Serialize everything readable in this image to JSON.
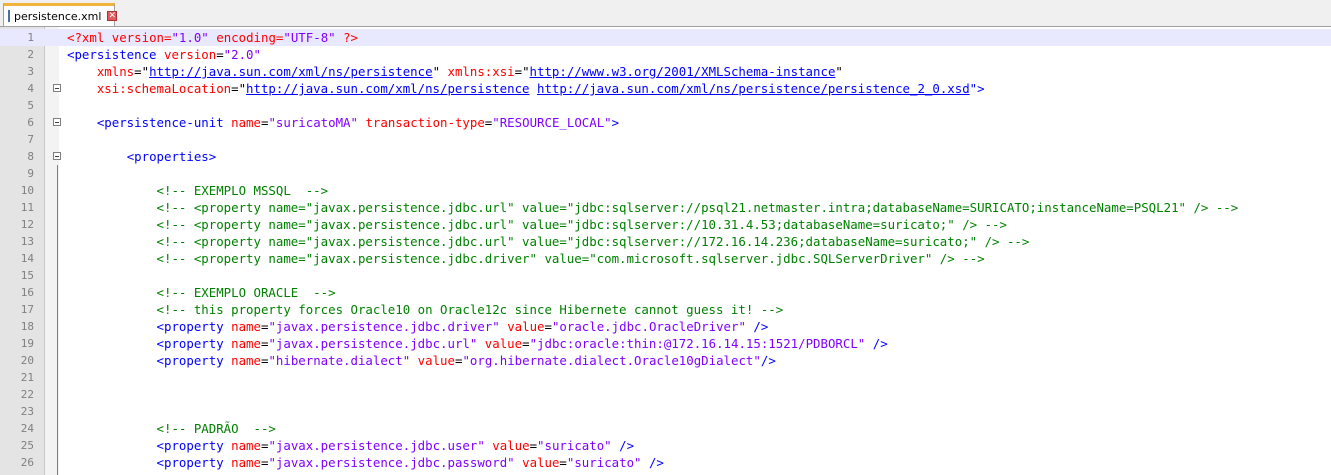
{
  "tab": {
    "filename": "persistence.xml",
    "close_glyph": "✕"
  },
  "colors": {
    "processing_instruction": "#ff0000",
    "tag": "#0000ff",
    "attribute": "#ff0000",
    "value": "#8000ff",
    "comment": "#008000",
    "active_line": "#e8e8ff"
  },
  "lines": [
    {
      "n": "1",
      "indent": "",
      "tokens": [
        {
          "t": "<?xml ",
          "c": "pi"
        },
        {
          "t": "version",
          "c": "attr"
        },
        {
          "t": "=",
          "c": "pi"
        },
        {
          "t": "\"1.0\"",
          "c": "val"
        },
        {
          "t": " ",
          "c": "plain"
        },
        {
          "t": "encoding",
          "c": "attr"
        },
        {
          "t": "=",
          "c": "pi"
        },
        {
          "t": "\"UTF-8\"",
          "c": "val"
        },
        {
          "t": " ?>",
          "c": "pi"
        }
      ]
    },
    {
      "n": "2",
      "indent": "",
      "tokens": [
        {
          "t": "<persistence ",
          "c": "tag"
        },
        {
          "t": "version",
          "c": "attr"
        },
        {
          "t": "=",
          "c": "plain"
        },
        {
          "t": "\"2.0\"",
          "c": "val"
        }
      ]
    },
    {
      "n": "3",
      "indent": "    ",
      "tokens": [
        {
          "t": "xmlns",
          "c": "attr"
        },
        {
          "t": "=\"",
          "c": "plain"
        },
        {
          "t": "http://java.sun.com/xml/ns/persistence",
          "c": "url"
        },
        {
          "t": "\" ",
          "c": "plain"
        },
        {
          "t": "xmlns:xsi",
          "c": "attr"
        },
        {
          "t": "=\"",
          "c": "plain"
        },
        {
          "t": "http://www.w3.org/2001/XMLSchema-instance",
          "c": "url"
        },
        {
          "t": "\"",
          "c": "plain"
        }
      ]
    },
    {
      "n": "4",
      "indent": "    ",
      "tokens": [
        {
          "t": "xsi:schemaLocation",
          "c": "attr"
        },
        {
          "t": "=\"",
          "c": "plain"
        },
        {
          "t": "http://java.sun.com/xml/ns/persistence",
          "c": "url"
        },
        {
          "t": " ",
          "c": "plain"
        },
        {
          "t": "http://java.sun.com/xml/ns/persistence/persistence_2_0.xsd",
          "c": "url"
        },
        {
          "t": "\">",
          "c": "tag"
        }
      ]
    },
    {
      "n": "5",
      "indent": "",
      "tokens": []
    },
    {
      "n": "6",
      "indent": "    ",
      "tokens": [
        {
          "t": "<persistence-unit ",
          "c": "tag"
        },
        {
          "t": "name",
          "c": "attr"
        },
        {
          "t": "=",
          "c": "plain"
        },
        {
          "t": "\"suricatoMA\"",
          "c": "val"
        },
        {
          "t": " ",
          "c": "plain"
        },
        {
          "t": "transaction-type",
          "c": "attr"
        },
        {
          "t": "=",
          "c": "plain"
        },
        {
          "t": "\"RESOURCE_LOCAL\"",
          "c": "val"
        },
        {
          "t": ">",
          "c": "tag"
        }
      ]
    },
    {
      "n": "7",
      "indent": "",
      "tokens": []
    },
    {
      "n": "8",
      "indent": "        ",
      "tokens": [
        {
          "t": "<properties>",
          "c": "tag"
        }
      ]
    },
    {
      "n": "9",
      "indent": "",
      "tokens": []
    },
    {
      "n": "10",
      "indent": "            ",
      "tokens": [
        {
          "t": "<!-- EXEMPLO MSSQL  -->",
          "c": "comment"
        }
      ]
    },
    {
      "n": "11",
      "indent": "            ",
      "tokens": [
        {
          "t": "<!-- <property name=\"javax.persistence.jdbc.url\" value=\"jdbc:sqlserver://psql21.netmaster.intra;databaseName=SURICATO;instanceName=PSQL21\" /> -->",
          "c": "comment"
        }
      ]
    },
    {
      "n": "12",
      "indent": "            ",
      "tokens": [
        {
          "t": "<!-- <property name=\"javax.persistence.jdbc.url\" value=\"jdbc:sqlserver://10.31.4.53;databaseName=suricato;\" /> -->",
          "c": "comment"
        }
      ]
    },
    {
      "n": "13",
      "indent": "            ",
      "tokens": [
        {
          "t": "<!-- <property name=\"javax.persistence.jdbc.url\" value=\"jdbc:sqlserver://172.16.14.236;databaseName=suricato;\" /> -->",
          "c": "comment"
        }
      ]
    },
    {
      "n": "14",
      "indent": "            ",
      "tokens": [
        {
          "t": "<!-- <property name=\"javax.persistence.jdbc.driver\" value=\"com.microsoft.sqlserver.jdbc.SQLServerDriver\" /> -->",
          "c": "comment"
        }
      ]
    },
    {
      "n": "15",
      "indent": "",
      "tokens": []
    },
    {
      "n": "16",
      "indent": "            ",
      "tokens": [
        {
          "t": "<!-- EXEMPLO ORACLE  -->",
          "c": "comment"
        }
      ]
    },
    {
      "n": "17",
      "indent": "            ",
      "tokens": [
        {
          "t": "<!-- this property forces Oracle10 on Oracle12c since Hibernete cannot guess it! -->",
          "c": "comment"
        }
      ]
    },
    {
      "n": "18",
      "indent": "            ",
      "tokens": [
        {
          "t": "<property ",
          "c": "tag"
        },
        {
          "t": "name",
          "c": "attr"
        },
        {
          "t": "=",
          "c": "plain"
        },
        {
          "t": "\"javax.persistence.jdbc.driver\"",
          "c": "val"
        },
        {
          "t": " ",
          "c": "plain"
        },
        {
          "t": "value",
          "c": "attr"
        },
        {
          "t": "=",
          "c": "plain"
        },
        {
          "t": "\"oracle.jdbc.OracleDriver\"",
          "c": "val"
        },
        {
          "t": " />",
          "c": "tag"
        }
      ]
    },
    {
      "n": "19",
      "indent": "            ",
      "tokens": [
        {
          "t": "<property ",
          "c": "tag"
        },
        {
          "t": "name",
          "c": "attr"
        },
        {
          "t": "=",
          "c": "plain"
        },
        {
          "t": "\"javax.persistence.jdbc.url\"",
          "c": "val"
        },
        {
          "t": " ",
          "c": "plain"
        },
        {
          "t": "value",
          "c": "attr"
        },
        {
          "t": "=",
          "c": "plain"
        },
        {
          "t": "\"jdbc:oracle:thin:@172.16.14.15:1521/PDBORCL\"",
          "c": "val"
        },
        {
          "t": " />",
          "c": "tag"
        }
      ]
    },
    {
      "n": "20",
      "indent": "            ",
      "tokens": [
        {
          "t": "<property ",
          "c": "tag"
        },
        {
          "t": "name",
          "c": "attr"
        },
        {
          "t": "=",
          "c": "plain"
        },
        {
          "t": "\"hibernate.dialect\"",
          "c": "val"
        },
        {
          "t": " ",
          "c": "plain"
        },
        {
          "t": "value",
          "c": "attr"
        },
        {
          "t": "=",
          "c": "plain"
        },
        {
          "t": "\"org.hibernate.dialect.Oracle10gDialect\"",
          "c": "val"
        },
        {
          "t": "/>",
          "c": "tag"
        }
      ]
    },
    {
      "n": "21",
      "indent": "",
      "tokens": []
    },
    {
      "n": "22",
      "indent": "",
      "tokens": []
    },
    {
      "n": "23",
      "indent": "",
      "tokens": []
    },
    {
      "n": "24",
      "indent": "            ",
      "tokens": [
        {
          "t": "<!-- PADRÃO  -->",
          "c": "comment"
        }
      ]
    },
    {
      "n": "25",
      "indent": "            ",
      "tokens": [
        {
          "t": "<property ",
          "c": "tag"
        },
        {
          "t": "name",
          "c": "attr"
        },
        {
          "t": "=",
          "c": "plain"
        },
        {
          "t": "\"javax.persistence.jdbc.user\"",
          "c": "val"
        },
        {
          "t": " ",
          "c": "plain"
        },
        {
          "t": "value",
          "c": "attr"
        },
        {
          "t": "=",
          "c": "plain"
        },
        {
          "t": "\"suricato\"",
          "c": "val"
        },
        {
          "t": " />",
          "c": "tag"
        }
      ]
    },
    {
      "n": "26",
      "indent": "            ",
      "tokens": [
        {
          "t": "<property ",
          "c": "tag"
        },
        {
          "t": "name",
          "c": "attr"
        },
        {
          "t": "=",
          "c": "plain"
        },
        {
          "t": "\"javax.persistence.jdbc.password\"",
          "c": "val"
        },
        {
          "t": " ",
          "c": "plain"
        },
        {
          "t": "value",
          "c": "attr"
        },
        {
          "t": "=",
          "c": "plain"
        },
        {
          "t": "\"suricato\"",
          "c": "val"
        },
        {
          "t": " />",
          "c": "tag"
        }
      ]
    }
  ]
}
